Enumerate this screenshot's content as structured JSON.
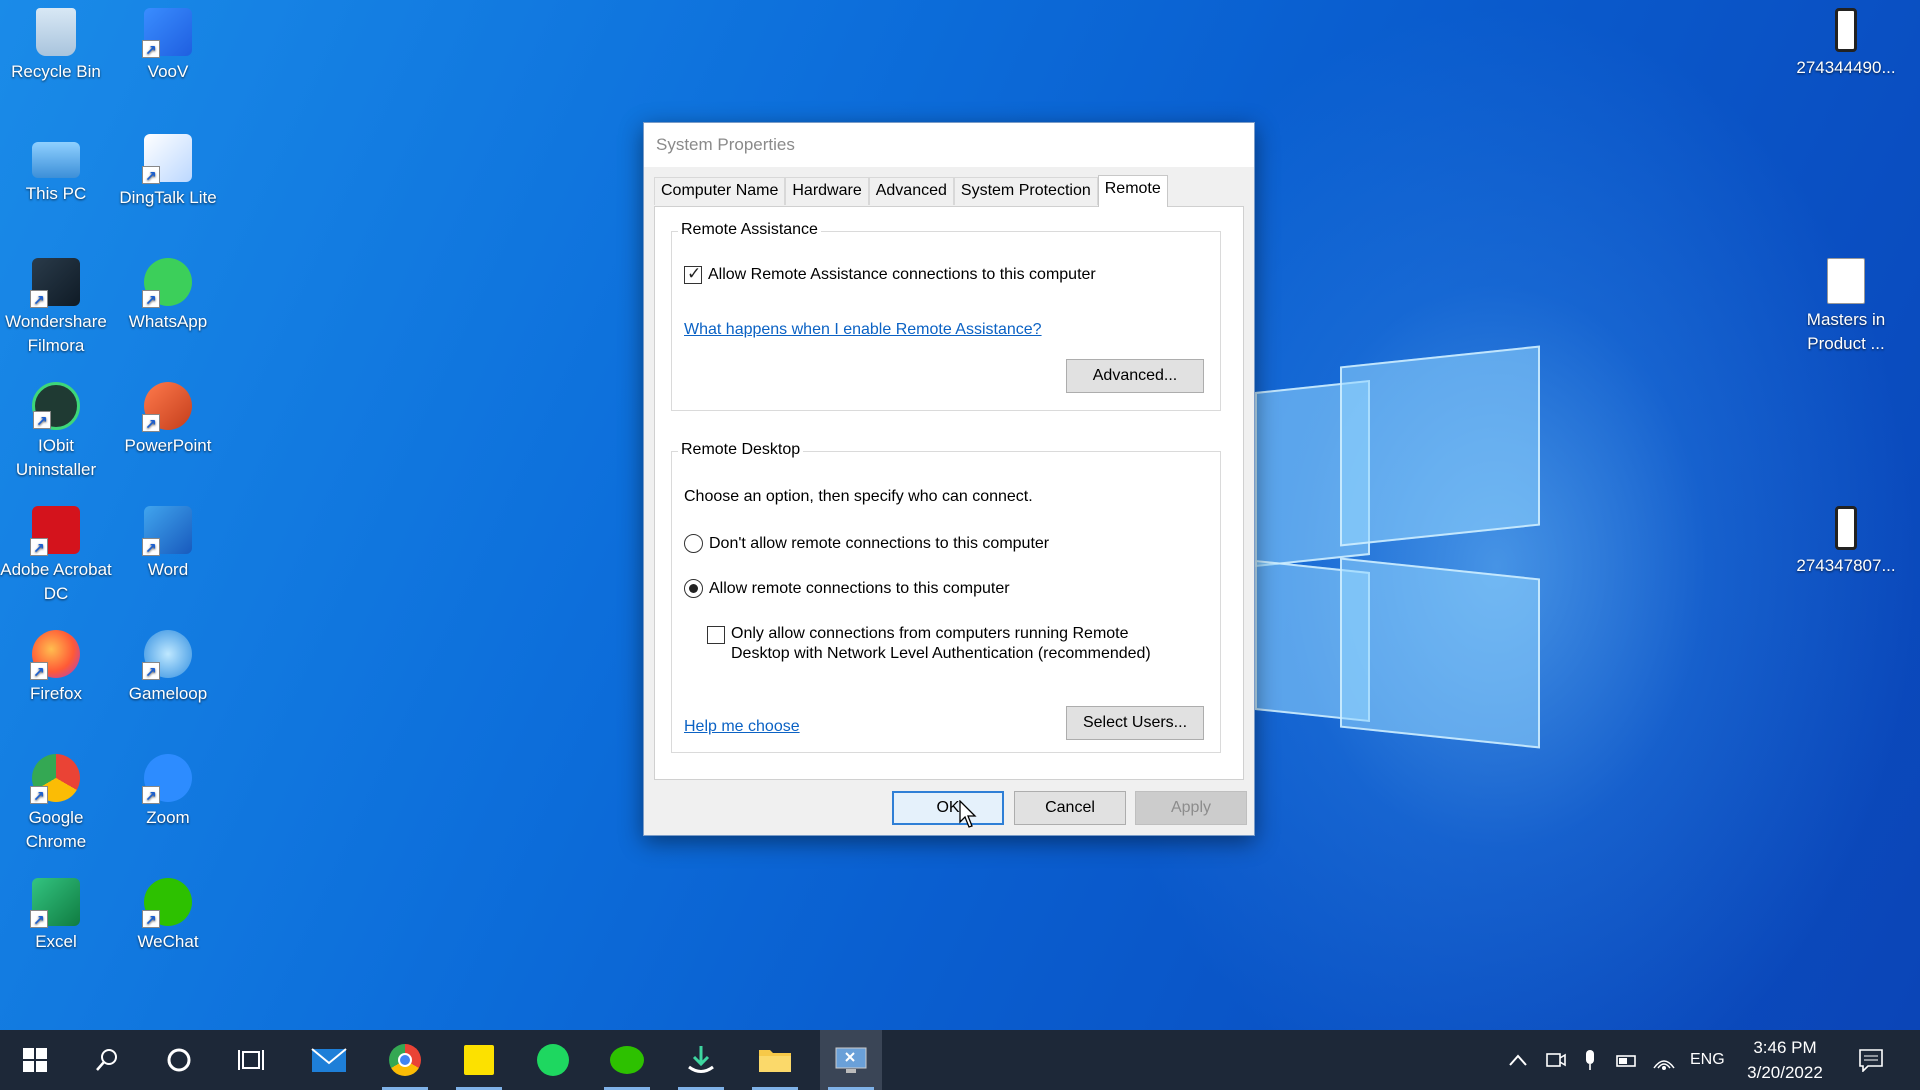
{
  "desktop": {
    "icons": [
      {
        "label": "Recycle Bin"
      },
      {
        "label": "VooV"
      },
      {
        "label": "This PC"
      },
      {
        "label": "DingTalk Lite"
      },
      {
        "label": "Wondershare Filmora"
      },
      {
        "label": "WhatsApp"
      },
      {
        "label": "IObit Uninstaller"
      },
      {
        "label": "PowerPoint"
      },
      {
        "label": "Adobe Acrobat DC"
      },
      {
        "label": "Word"
      },
      {
        "label": "Firefox"
      },
      {
        "label": "Gameloop"
      },
      {
        "label": "Google Chrome"
      },
      {
        "label": "Zoom"
      },
      {
        "label": "Excel"
      },
      {
        "label": "WeChat"
      },
      {
        "label": "274344490..."
      },
      {
        "label": "Masters in Product ..."
      },
      {
        "label": "274347807..."
      }
    ]
  },
  "dialog": {
    "title": "System Properties",
    "tabs": [
      "Computer Name",
      "Hardware",
      "Advanced",
      "System Protection",
      "Remote"
    ],
    "remote_assistance": {
      "legend": "Remote Assistance",
      "allow_label": "Allow Remote Assistance connections to this computer",
      "allow_checked": true,
      "help_link": "What happens when I enable Remote Assistance?",
      "advanced_button": "Advanced..."
    },
    "remote_desktop": {
      "legend": "Remote Desktop",
      "instruction": "Choose an option, then specify who can connect.",
      "option_dont_allow": "Don't allow remote connections to this computer",
      "option_allow": "Allow remote connections to this computer",
      "selected_option": "allow",
      "nla_line1": "Only allow connections from computers running Remote",
      "nla_line2": "Desktop with Network Level Authentication (recommended)",
      "nla_checked": false,
      "help_link": "Help me choose",
      "select_users_button": "Select Users..."
    },
    "buttons": {
      "ok": "OK",
      "cancel": "Cancel",
      "apply": "Apply"
    }
  },
  "taskbar": {
    "tray": {
      "language": "ENG",
      "time": "3:46 PM",
      "date": "3/20/2022"
    }
  }
}
